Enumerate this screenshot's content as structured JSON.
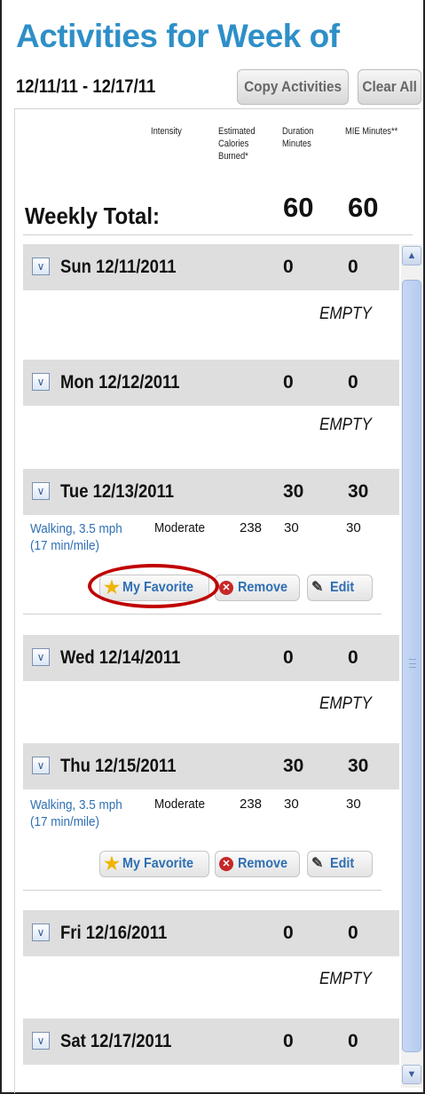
{
  "header": {
    "title": "Activities for Week of",
    "date_range": "12/11/11 - 12/17/11",
    "copy_label": "Copy Activities",
    "clear_label": "Clear All"
  },
  "columns": {
    "intensity": "Intensity",
    "calories": "Estimated Calories Burned*",
    "duration": "Duration Minutes",
    "mie": "MIE Minutes**"
  },
  "weekly": {
    "label": "Weekly Total:",
    "duration": "60",
    "mie": "60"
  },
  "days": [
    {
      "label": "Sun 12/11/2011",
      "duration": "0",
      "mie": "0",
      "empty": "EMPTY"
    },
    {
      "label": "Mon 12/12/2011",
      "duration": "0",
      "mie": "0",
      "empty": "EMPTY"
    },
    {
      "label": "Tue 12/13/2011",
      "duration": "30",
      "mie": "30",
      "activity": {
        "name_line1": "Walking, 3.5 mph",
        "name_line2": "(17 min/mile)",
        "intensity": "Moderate",
        "calories": "238",
        "duration": "30",
        "mie": "30"
      }
    },
    {
      "label": "Wed 12/14/2011",
      "duration": "0",
      "mie": "0",
      "empty": "EMPTY"
    },
    {
      "label": "Thu 12/15/2011",
      "duration": "30",
      "mie": "30",
      "activity": {
        "name_line1": "Walking, 3.5 mph",
        "name_line2": "(17 min/mile)",
        "intensity": "Moderate",
        "calories": "238",
        "duration": "30",
        "mie": "30"
      }
    },
    {
      "label": "Fri 12/16/2011",
      "duration": "0",
      "mie": "0",
      "empty": "EMPTY"
    },
    {
      "label": "Sat 12/17/2011",
      "duration": "0",
      "mie": "0"
    }
  ],
  "actions": {
    "favorite": "My Favorite",
    "remove": "Remove",
    "edit": "Edit"
  },
  "icons": {
    "toggle": "chevron-down-icon",
    "favorite": "star-icon",
    "remove": "remove-icon",
    "edit": "edit-icon",
    "scroll_up": "scroll-up-icon",
    "scroll_down": "scroll-down-icon"
  },
  "colors": {
    "title": "#2e8fc8",
    "link": "#2f6fb3",
    "highlight": "#c00000",
    "header_bg": "#dedede"
  }
}
